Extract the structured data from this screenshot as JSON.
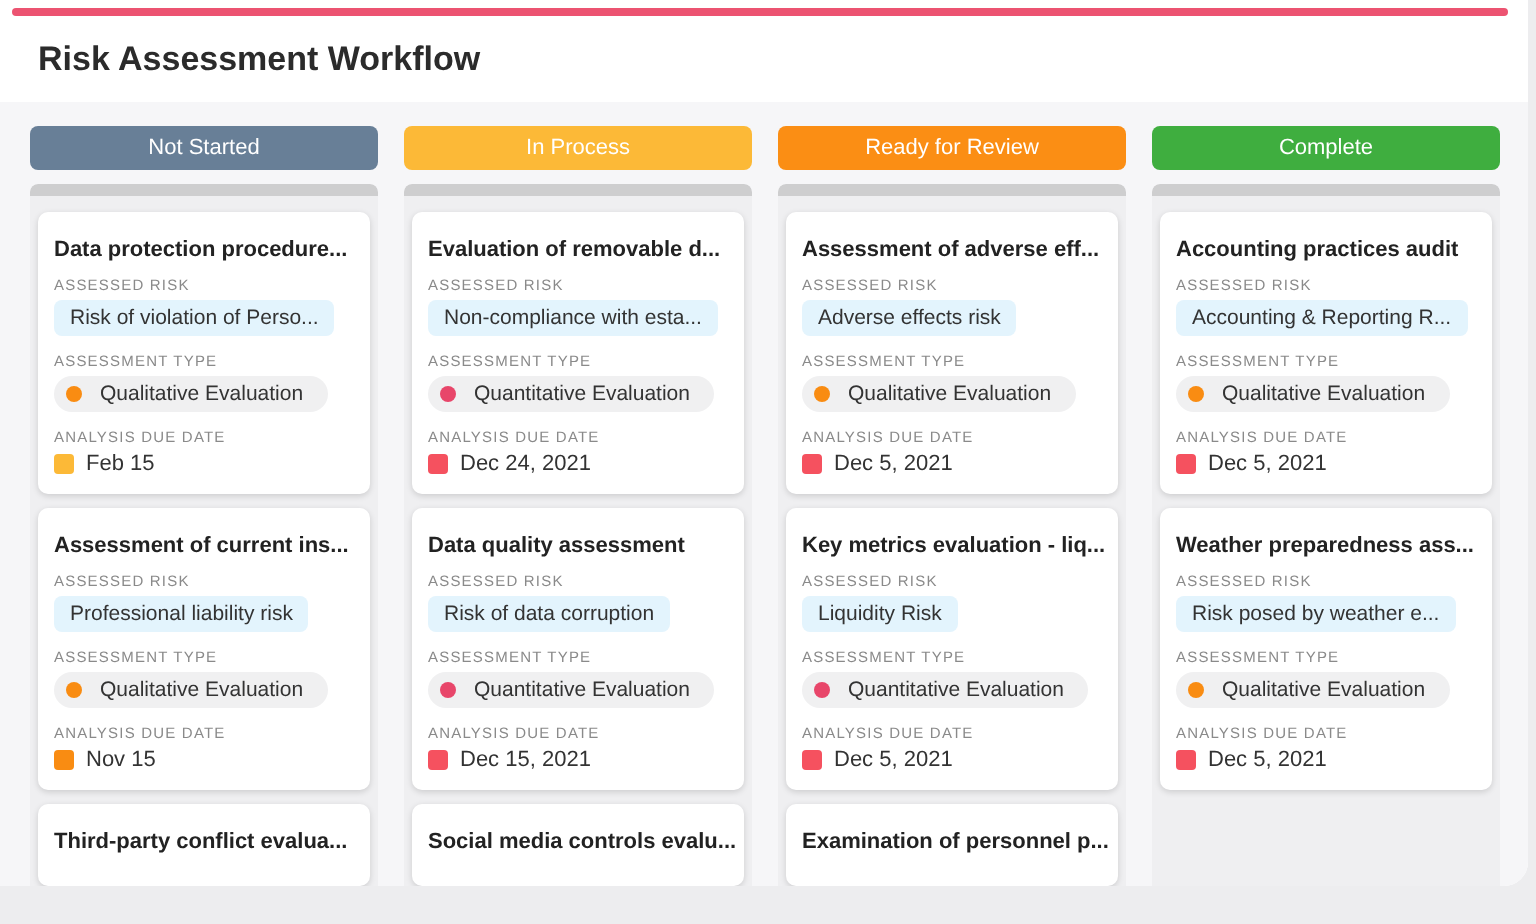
{
  "title": "Risk Assessment Workflow",
  "columns": [
    {
      "name": "Not Started",
      "color": "#687f97",
      "cards": [
        {
          "title": "Data protection procedure...",
          "risk_label": "ASSESSED RISK",
          "risk": "Risk of violation of Perso...",
          "type_label": "ASSESSMENT TYPE",
          "type": {
            "text": "Qualitative Evaluation",
            "color": "#f98c12"
          },
          "date_label": "ANALYSIS DUE DATE",
          "date": {
            "text": "Feb 15",
            "color": "#fcb937"
          }
        },
        {
          "title": "Assessment of current ins...",
          "risk_label": "ASSESSED RISK",
          "risk": "Professional liability risk",
          "type_label": "ASSESSMENT TYPE",
          "type": {
            "text": "Qualitative Evaluation",
            "color": "#f98c12"
          },
          "date_label": "ANALYSIS DUE DATE",
          "date": {
            "text": "Nov 15",
            "color": "#f98c12"
          }
        },
        {
          "title": "Third-party conflict evalua..."
        }
      ]
    },
    {
      "name": "In Process",
      "color": "#fcb937",
      "cards": [
        {
          "title": "Evaluation of removable d...",
          "risk_label": "ASSESSED RISK",
          "risk": "Non-compliance with esta...",
          "type_label": "ASSESSMENT TYPE",
          "type": {
            "text": "Quantitative Evaluation",
            "color": "#e8466a"
          },
          "date_label": "ANALYSIS DUE DATE",
          "date": {
            "text": "Dec 24, 2021",
            "color": "#f5515f"
          }
        },
        {
          "title": "Data quality assessment",
          "risk_label": "ASSESSED RISK",
          "risk": "Risk of data corruption",
          "type_label": "ASSESSMENT TYPE",
          "type": {
            "text": "Quantitative Evaluation",
            "color": "#e8466a"
          },
          "date_label": "ANALYSIS DUE DATE",
          "date": {
            "text": "Dec 15, 2021",
            "color": "#f5515f"
          }
        },
        {
          "title": "Social media controls evalu..."
        }
      ]
    },
    {
      "name": "Ready for Review",
      "color": "#fb8e14",
      "cards": [
        {
          "title": "Assessment of adverse eff...",
          "risk_label": "ASSESSED RISK",
          "risk": "Adverse effects risk",
          "type_label": "ASSESSMENT TYPE",
          "type": {
            "text": "Qualitative Evaluation",
            "color": "#f98c12"
          },
          "date_label": "ANALYSIS DUE DATE",
          "date": {
            "text": "Dec 5, 2021",
            "color": "#f5515f"
          }
        },
        {
          "title": "Key metrics evaluation - liq...",
          "risk_label": "ASSESSED RISK",
          "risk": "Liquidity Risk",
          "type_label": "ASSESSMENT TYPE",
          "type": {
            "text": "Quantitative Evaluation",
            "color": "#e8466a"
          },
          "date_label": "ANALYSIS DUE DATE",
          "date": {
            "text": "Dec 5, 2021",
            "color": "#f5515f"
          }
        },
        {
          "title": "Examination of personnel p..."
        }
      ]
    },
    {
      "name": "Complete",
      "color": "#3fae3f",
      "cards": [
        {
          "title": "Accounting practices audit",
          "risk_label": "ASSESSED RISK",
          "risk": "Accounting & Reporting R...",
          "type_label": "ASSESSMENT TYPE",
          "type": {
            "text": "Qualitative Evaluation",
            "color": "#f98c12"
          },
          "date_label": "ANALYSIS DUE DATE",
          "date": {
            "text": "Dec 5, 2021",
            "color": "#f5515f"
          }
        },
        {
          "title": "Weather preparedness ass...",
          "risk_label": "ASSESSED RISK",
          "risk": "Risk posed by weather e...",
          "type_label": "ASSESSMENT TYPE",
          "type": {
            "text": "Qualitative Evaluation",
            "color": "#f98c12"
          },
          "date_label": "ANALYSIS DUE DATE",
          "date": {
            "text": "Dec 5, 2021",
            "color": "#f5515f"
          }
        }
      ]
    }
  ]
}
